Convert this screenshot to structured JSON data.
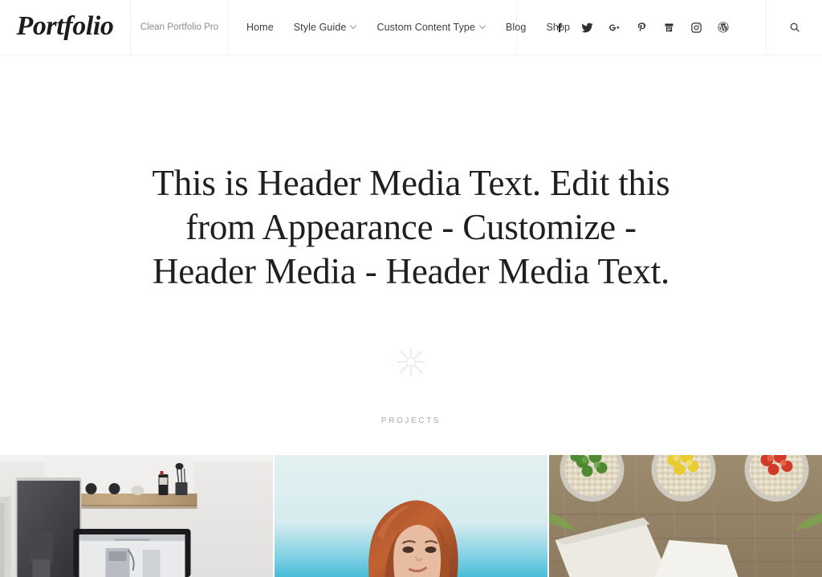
{
  "header": {
    "brand": "Portfolio",
    "tagline": "Clean Portfolio Pro",
    "nav": [
      {
        "label": "Home",
        "has_dropdown": false
      },
      {
        "label": "Style Guide",
        "has_dropdown": true
      },
      {
        "label": "Custom Content Type",
        "has_dropdown": true
      },
      {
        "label": "Blog",
        "has_dropdown": false
      },
      {
        "label": "Shop",
        "has_dropdown": false
      }
    ],
    "social": [
      {
        "name": "facebook-icon",
        "label": "Facebook"
      },
      {
        "name": "twitter-icon",
        "label": "Twitter"
      },
      {
        "name": "google-plus-icon",
        "label": "Google Plus"
      },
      {
        "name": "pinterest-icon",
        "label": "Pinterest"
      },
      {
        "name": "youtube-icon",
        "label": "YouTube"
      },
      {
        "name": "instagram-icon",
        "label": "Instagram"
      },
      {
        "name": "wordpress-icon",
        "label": "WordPress"
      }
    ],
    "search_label": "Search"
  },
  "hero": {
    "heading": "This is Header Media Text. Edit this from Appearance - Customize - Header Media - Header Media Text.",
    "ornament": "star-ornament-icon"
  },
  "projects": {
    "section_label": "PROJECTS",
    "items": [
      {
        "name": "project-tile-workspace",
        "description": "Desk workspace with monitors and wooden shelf"
      },
      {
        "name": "project-tile-portrait",
        "description": "Portrait of red-haired woman against blue sky"
      },
      {
        "name": "project-tile-plants",
        "description": "Three pots with colored moss on weathered wood"
      }
    ]
  },
  "colors": {
    "brand_text": "#1c1c1c",
    "nav_text": "#3d3d3d",
    "muted_text": "#8c8c8c",
    "section_label": "#a8a8ae",
    "divider": "#f1f1f1",
    "background": "#ffffff"
  }
}
